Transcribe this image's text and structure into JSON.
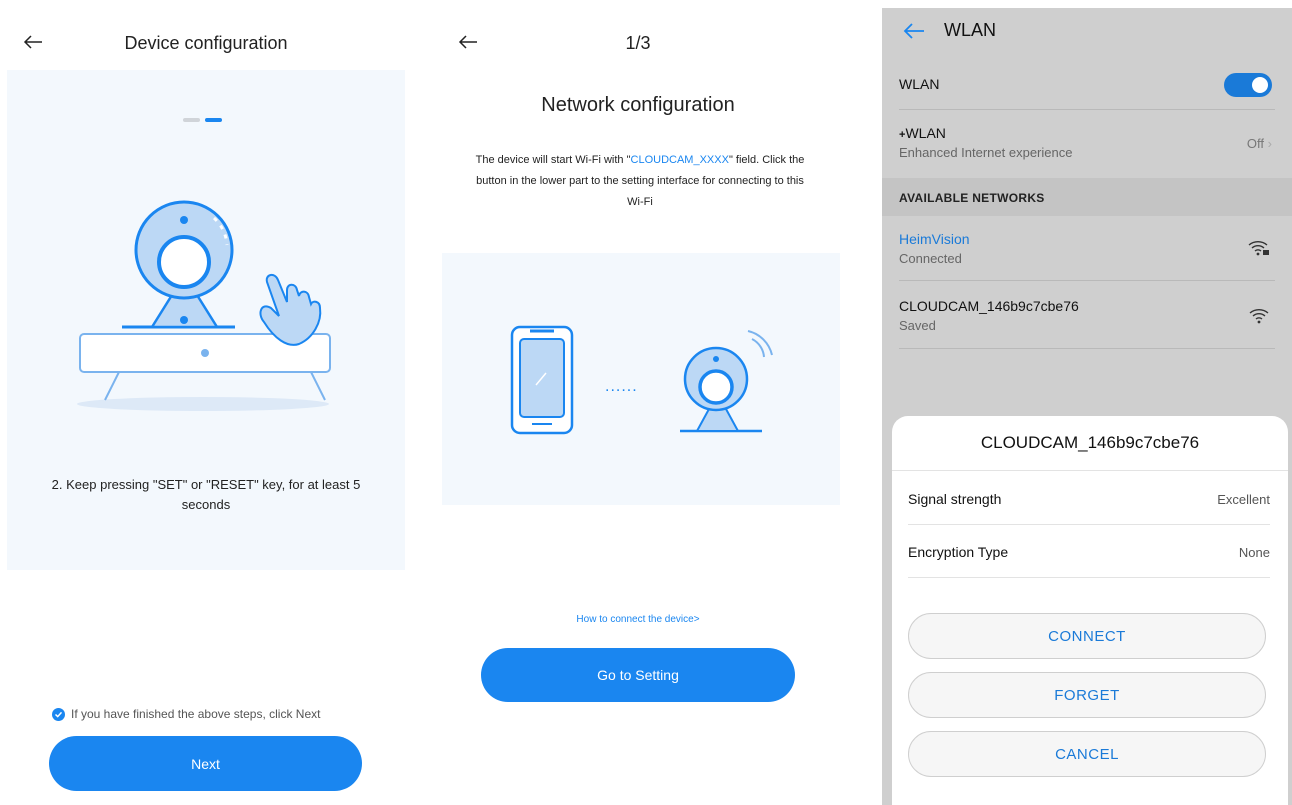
{
  "panel1": {
    "title": "Device configuration",
    "step_text": "2. Keep pressing \"SET\" or \"RESET\" key, for at least 5 seconds",
    "confirm_text": "If you have finished the above steps, click Next",
    "next_label": "Next",
    "progress_dots": 2,
    "active_dot": 2
  },
  "panel2": {
    "step_counter": "1/3",
    "heading": "Network configuration",
    "desc_prefix": "The device will start Wi-Fi with \"",
    "desc_highlight": "CLOUDCAM_XXXX",
    "desc_suffix": "\" field. Click the button in the lower part to the setting interface for connecting to this Wi-Fi",
    "dots": "......",
    "help_link": "How to connect the device>",
    "button_label": "Go to Setting"
  },
  "panel3": {
    "title": "WLAN",
    "wlan_label": "WLAN",
    "wlan_enabled": true,
    "wlan_plus": {
      "label": "WLAN",
      "sub": "Enhanced Internet experience",
      "value": "Off"
    },
    "section_label": "AVAILABLE NETWORKS",
    "networks": [
      {
        "name": "HeimVision",
        "status": "Connected",
        "secured": true
      },
      {
        "name": "CLOUDCAM_146b9c7cbe76",
        "status": "Saved",
        "secured": false
      }
    ],
    "dialog": {
      "title": "CLOUDCAM_146b9c7cbe76",
      "rows": [
        {
          "label": "Signal strength",
          "value": "Excellent"
        },
        {
          "label": "Encryption Type",
          "value": "None"
        }
      ],
      "buttons": [
        "CONNECT",
        "FORGET",
        "CANCEL"
      ]
    }
  },
  "colors": {
    "accent": "#1a86f0",
    "card_bg": "#f3f8fd",
    "wlan_bg": "#cfcfcf"
  }
}
